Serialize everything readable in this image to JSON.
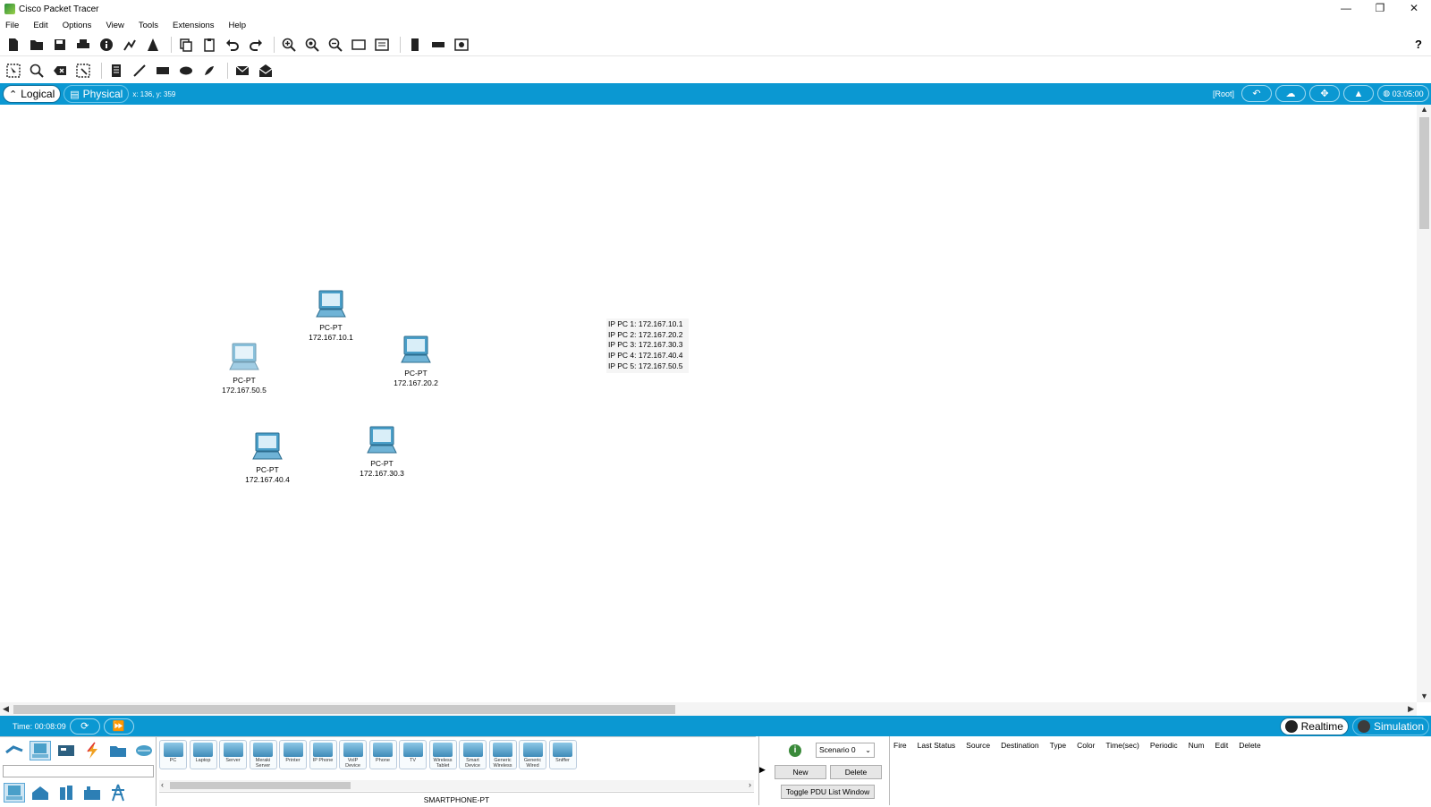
{
  "window": {
    "title": "Cisco Packet Tracer",
    "minimize": "—",
    "restore": "❐",
    "close": "✕"
  },
  "menu": [
    "File",
    "Edit",
    "Options",
    "View",
    "Tools",
    "Extensions",
    "Help"
  ],
  "help_label": "?",
  "workspace": {
    "logical_label": "Logical",
    "physical_label": "Physical",
    "coords": "x: 136, y: 359",
    "root_label": "[Root]",
    "clock": "03:05:00"
  },
  "devices": [
    {
      "name": "PC-PT",
      "ip": "172.167.10.1"
    },
    {
      "name": "PC-PT",
      "ip": "172.167.20.2"
    },
    {
      "name": "PC-PT",
      "ip": "172.167.50.5"
    },
    {
      "name": "PC-PT",
      "ip": "172.167.40.4"
    },
    {
      "name": "PC-PT",
      "ip": "172.167.30.3"
    }
  ],
  "note_lines": [
    "IP PC 1: 172.167.10.1",
    "IP PC 2: 172.167.20.2",
    "IP PC 3: 172.167.30.3",
    "IP PC 4: 172.167.40.4",
    "IP PC 5: 172.167.50.5"
  ],
  "time": {
    "label": "Time: 00:08:09"
  },
  "modes": {
    "realtime": "Realtime",
    "simulation": "Simulation"
  },
  "device_library": {
    "tiles": [
      "PC",
      "Laptop",
      "Server",
      "Meraki Server",
      "Printer",
      "IP Phone",
      "VoIP Device",
      "Phone",
      "TV",
      "Wireless Tablet",
      "Smart Device",
      "Generic Wireless",
      "Generic Wired",
      "Sniffer"
    ],
    "selected_name": "SMARTPHONE-PT"
  },
  "pdu": {
    "scenario": "Scenario 0",
    "new_label": "New",
    "delete_label": "Delete",
    "toggle_label": "Toggle PDU List Window",
    "headers": [
      "Fire",
      "Last Status",
      "Source",
      "Destination",
      "Type",
      "Color",
      "Time(sec)",
      "Periodic",
      "Num",
      "Edit",
      "Delete"
    ]
  },
  "colors": {
    "accent": "#0b98d2",
    "pc_screen": "#4a9fc9"
  }
}
